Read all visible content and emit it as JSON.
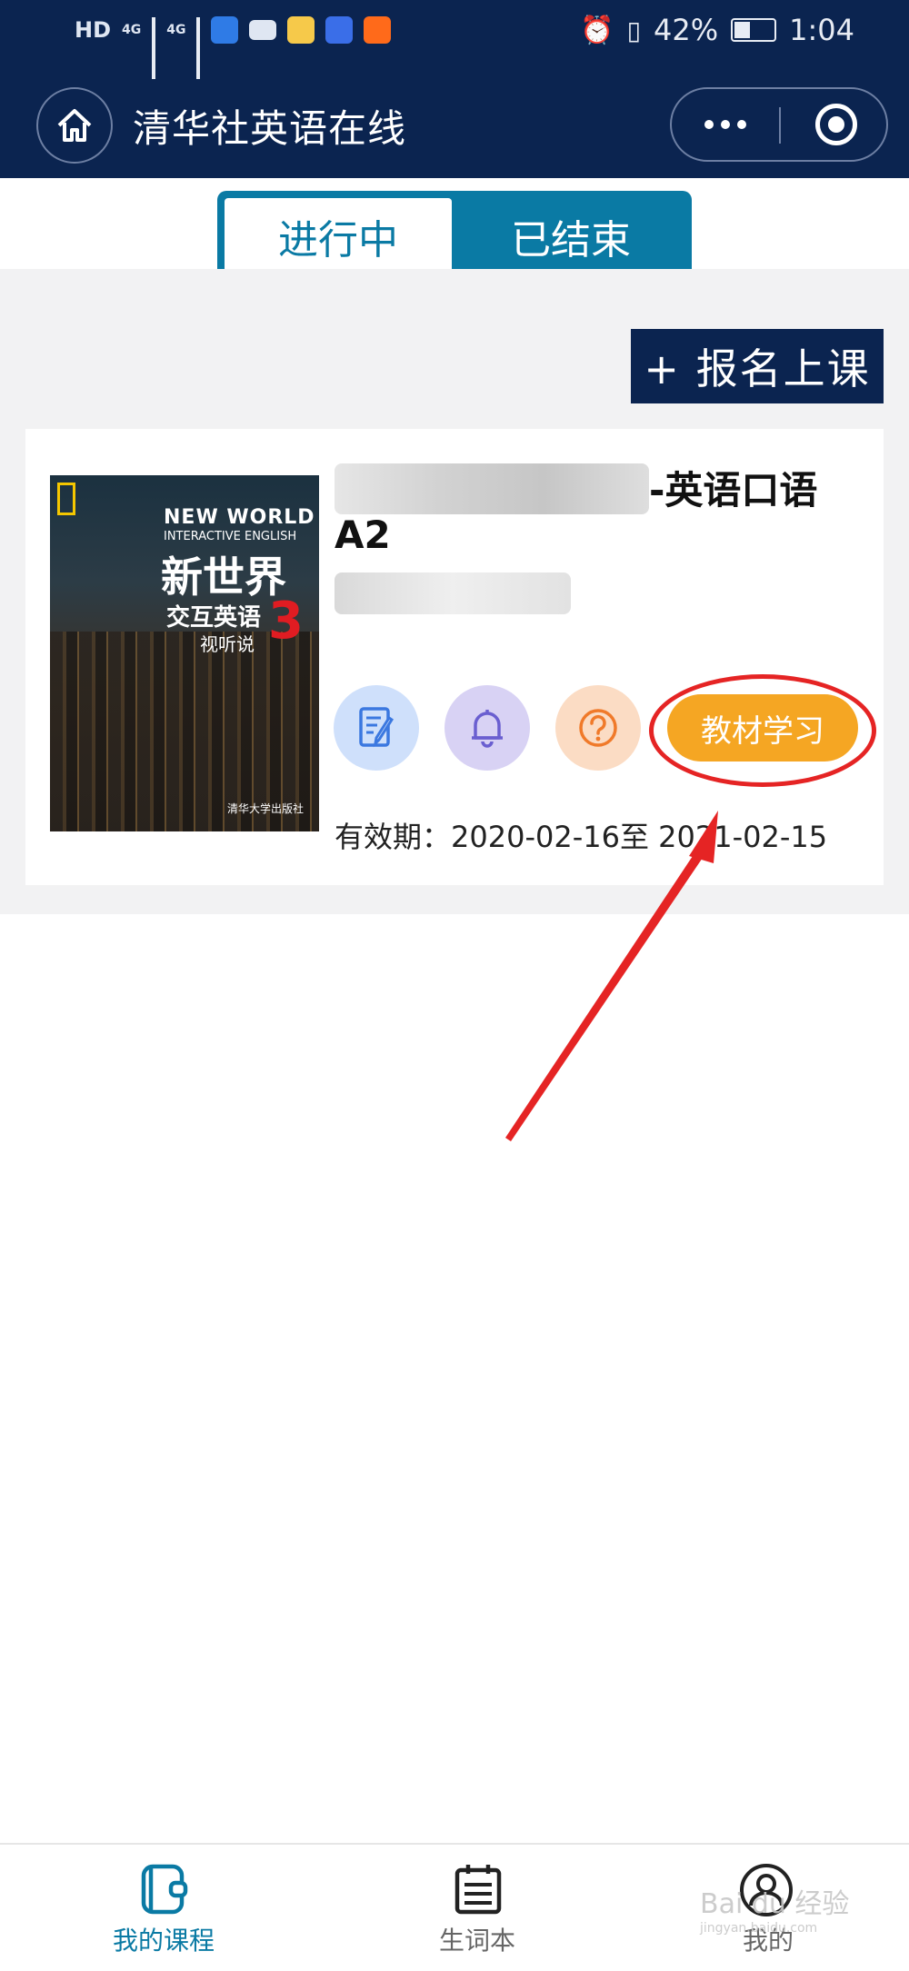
{
  "status_bar": {
    "hd_label": "HD",
    "network_1": "4G",
    "network_2": "4G",
    "battery_percent": "42%",
    "time": "1:04"
  },
  "header": {
    "title": "清华社英语在线"
  },
  "tabs": [
    {
      "label": "进行中",
      "active": true
    },
    {
      "label": "已结束",
      "active": false
    }
  ],
  "enroll_button": "+ 报名上课",
  "course": {
    "title_suffix": "-英语口语",
    "title_line2": "A2",
    "cover": {
      "brand": "NEW WORLD",
      "subtitle": "INTERACTIVE ENGLISH",
      "title": "新世界",
      "series": "交互英语",
      "series2": "视听说",
      "volume": "3",
      "publisher": "清华大学出版社"
    },
    "study_button": "教材学习",
    "validity": "有效期：2020-02-16至 2021-02-15"
  },
  "bottom_nav": [
    {
      "label": "我的课程",
      "icon": "notebook-icon",
      "active": true
    },
    {
      "label": "生词本",
      "icon": "calendar-list-icon",
      "active": false
    },
    {
      "label": "我的",
      "icon": "user-icon",
      "active": false
    }
  ],
  "watermark": {
    "text": "Bai du 经验",
    "url": "jingyan.baidu.com"
  },
  "colors": {
    "header_bg": "#0b2450",
    "accent": "#0a7aa4",
    "study_button": "#f5a623",
    "annotation": "#e52424"
  }
}
